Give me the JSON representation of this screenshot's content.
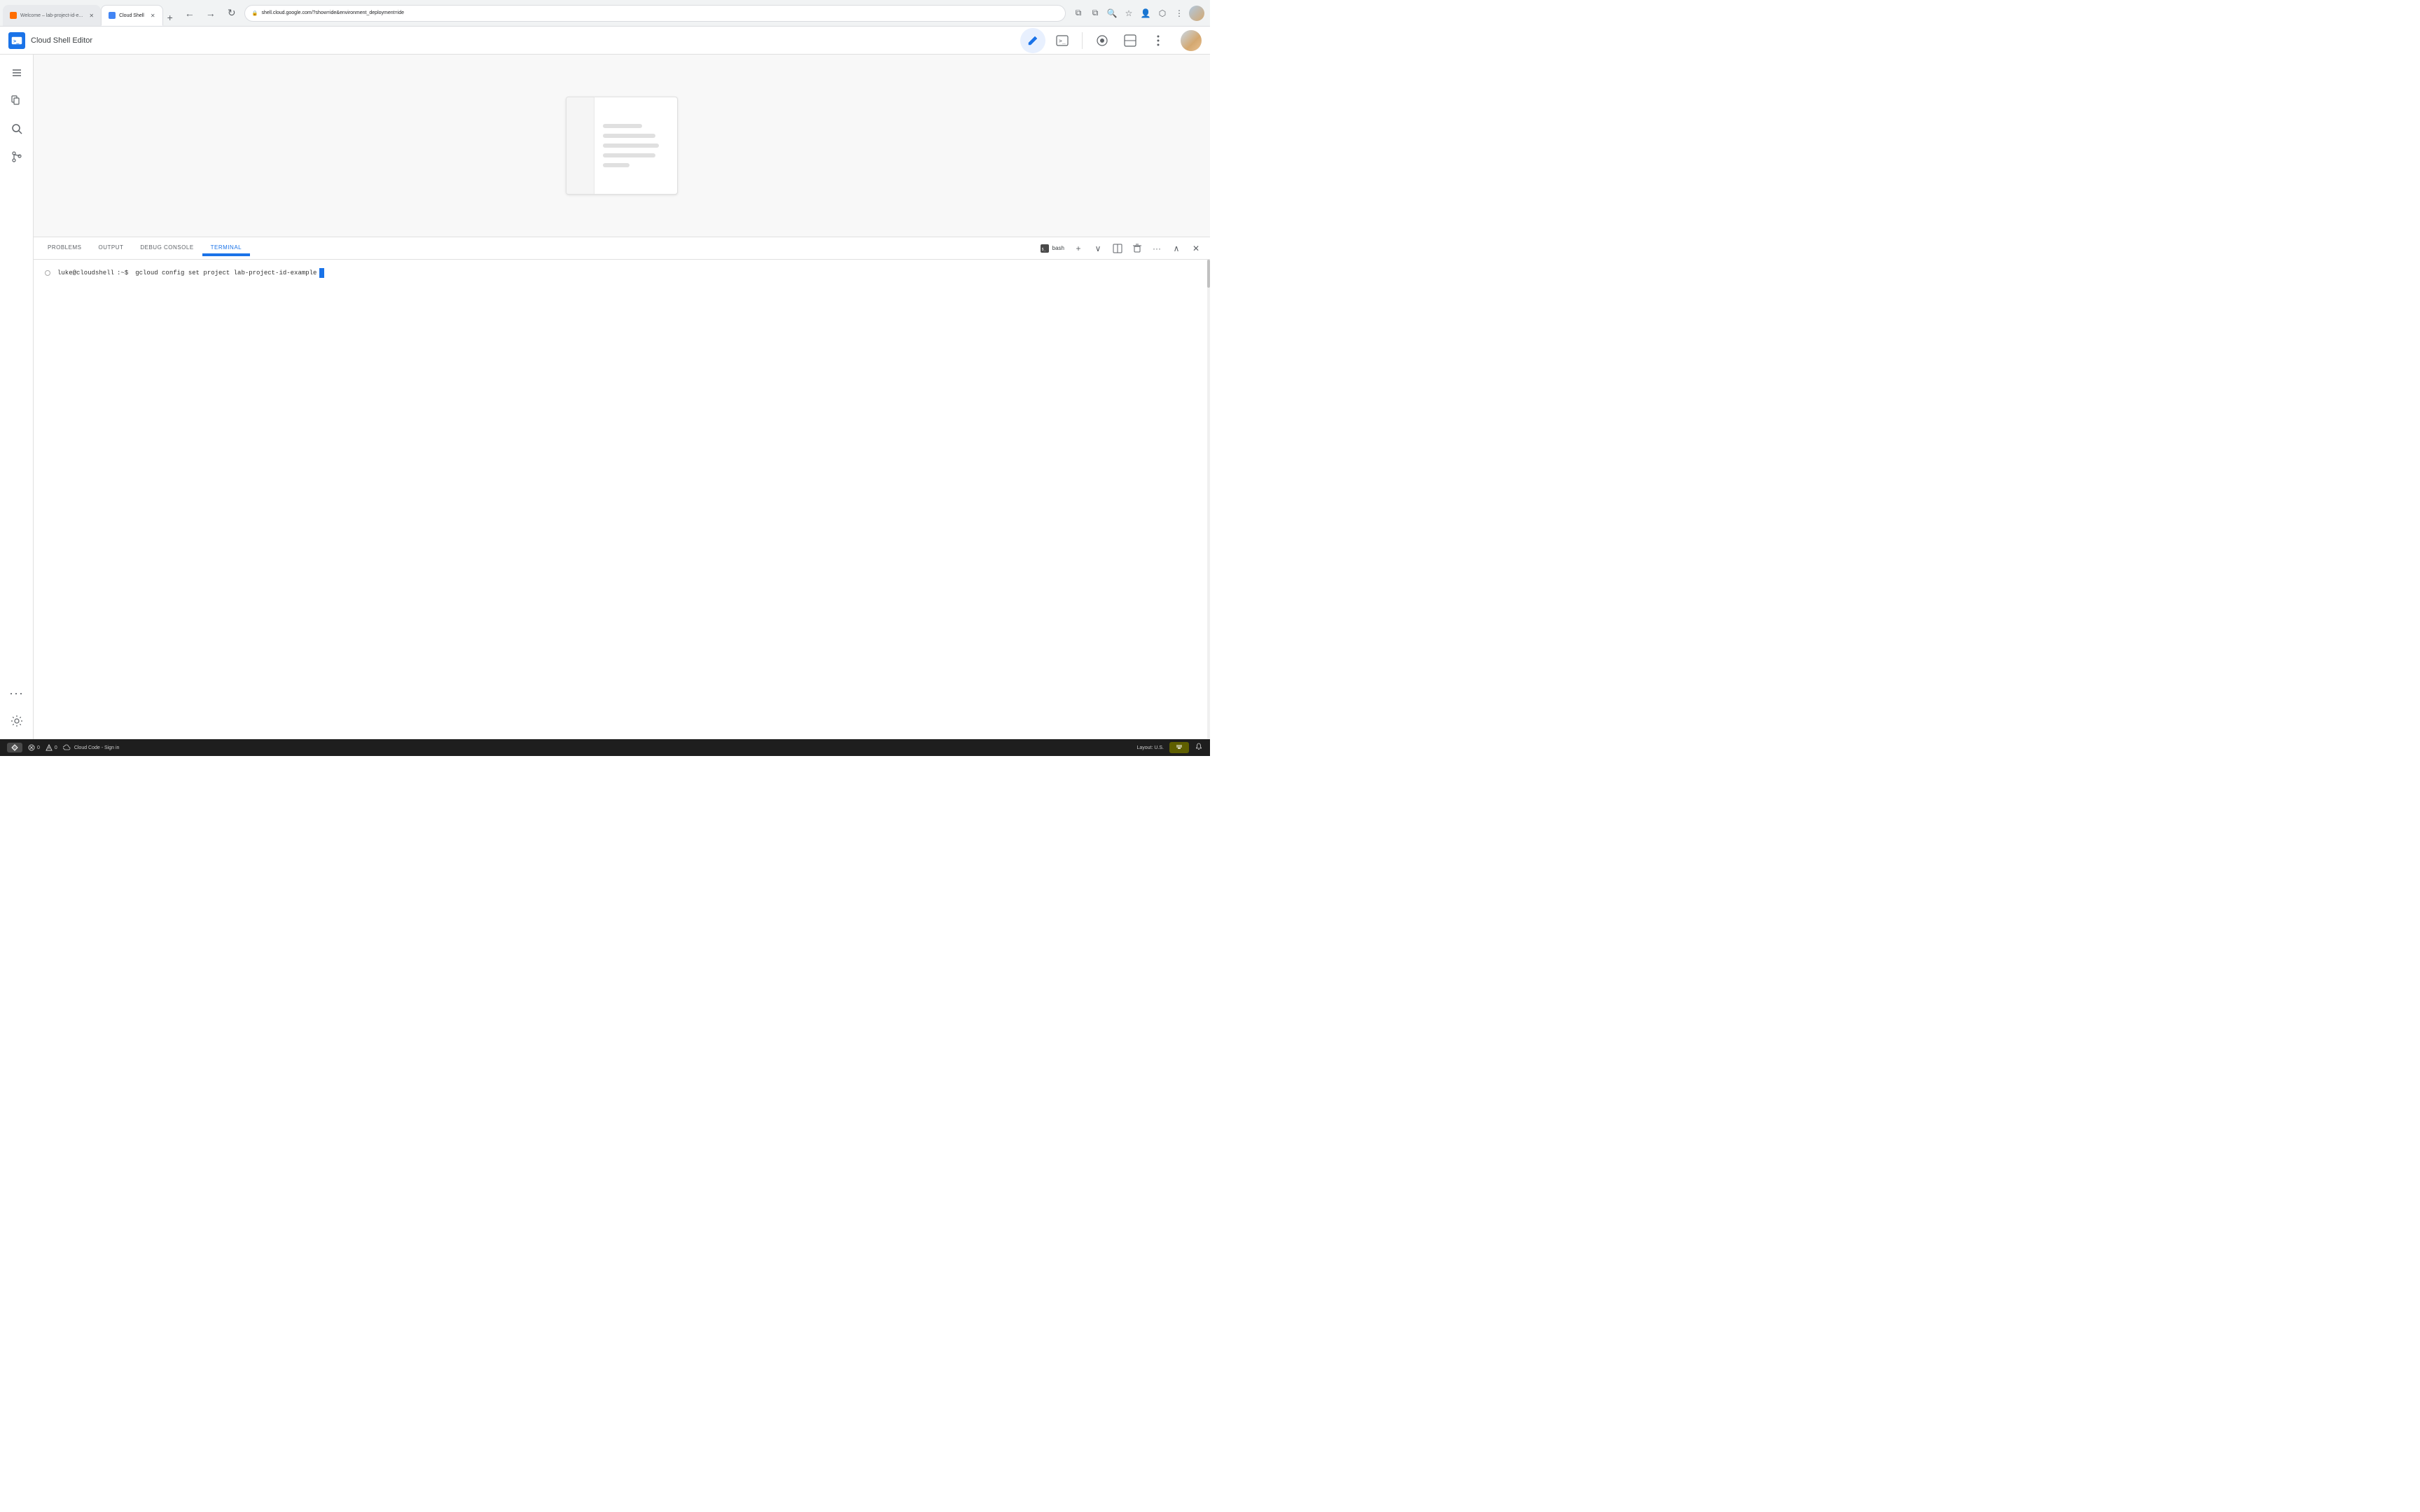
{
  "browser": {
    "tabs": [
      {
        "id": "tab1",
        "label": "Welcome – lab-project-id-e...",
        "favicon_color": "#ff6d00",
        "active": false
      },
      {
        "id": "tab2",
        "label": "Cloud Shell",
        "favicon_color": "#1a73e8",
        "active": true
      }
    ],
    "new_tab_label": "+",
    "address": "shell.cloud.google.com/?show=ide&environment_deployment=ide",
    "lock_icon": "🔒"
  },
  "header": {
    "title": "Cloud Shell Editor",
    "edit_icon": "✏️",
    "terminal_icon": ">_",
    "preview_icon": "◉",
    "layout_icon": "⬜",
    "more_icon": "⋮"
  },
  "sidebar": {
    "items": [
      {
        "id": "menu",
        "icon": "☰",
        "label": "menu-icon"
      },
      {
        "id": "files",
        "icon": "⧉",
        "label": "files-icon"
      },
      {
        "id": "search",
        "icon": "🔍",
        "label": "search-icon"
      },
      {
        "id": "git",
        "icon": "⑂",
        "label": "git-icon"
      },
      {
        "id": "more",
        "icon": "···",
        "label": "more-icon"
      }
    ],
    "bottom_items": [
      {
        "id": "settings",
        "icon": "⚙",
        "label": "settings-icon"
      }
    ]
  },
  "panel": {
    "tabs": [
      {
        "id": "problems",
        "label": "PROBLEMS",
        "active": false
      },
      {
        "id": "output",
        "label": "OUTPUT",
        "active": false
      },
      {
        "id": "debug_console",
        "label": "DEBUG CONSOLE",
        "active": false
      },
      {
        "id": "terminal",
        "label": "TERMINAL",
        "active": true
      }
    ],
    "bash_label": "bash",
    "actions": {
      "new_terminal": "+",
      "split": "⊟",
      "trash": "🗑",
      "more": "···",
      "chevron_up": "∧",
      "close": "✕"
    }
  },
  "terminal": {
    "prompt_user": "luke@cloudshell",
    "prompt_path": ":~$",
    "command": "gcloud config set project lab-project-id-example"
  },
  "status_bar": {
    "left_btn": "⊗",
    "errors": "0",
    "warnings_icon": "△",
    "warnings": "0",
    "cloud_icon": "☁",
    "cloud_code_label": "Cloud Code - Sign in",
    "layout_label": "Layout: U.S.",
    "remote_icon": "⚡",
    "bell_icon": "🔔"
  }
}
